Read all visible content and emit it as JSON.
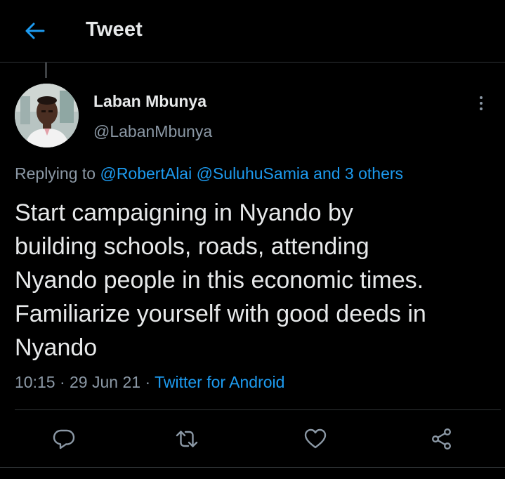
{
  "header": {
    "title": "Tweet",
    "back_icon": "arrow-left-icon",
    "accent": "#1d9bf0"
  },
  "author": {
    "display_name": "Laban Mbunya",
    "handle": "@LabanMbunya",
    "avatar": "profile-photo"
  },
  "reply": {
    "prefix": "Replying to",
    "mentions": [
      "@RobertAlai",
      "@SuluhuSamia"
    ],
    "others": "and 3 others"
  },
  "tweet": {
    "text": "Start campaigning in Nyando by\nbuilding schools, roads, attending\nNyando people in this economic times.\nFamiliarize yourself with good deeds in\nNyando",
    "time": "10:15",
    "separator": "·",
    "date": "29 Jun 21",
    "source": "Twitter for Android"
  },
  "actions": [
    "reply-icon",
    "retweet-icon",
    "like-icon",
    "share-icon"
  ],
  "colors": {
    "background": "#000000",
    "text": "#e7e9ea",
    "muted": "#8b98a5",
    "link": "#1d9bf0",
    "divider": "#2f3336"
  }
}
